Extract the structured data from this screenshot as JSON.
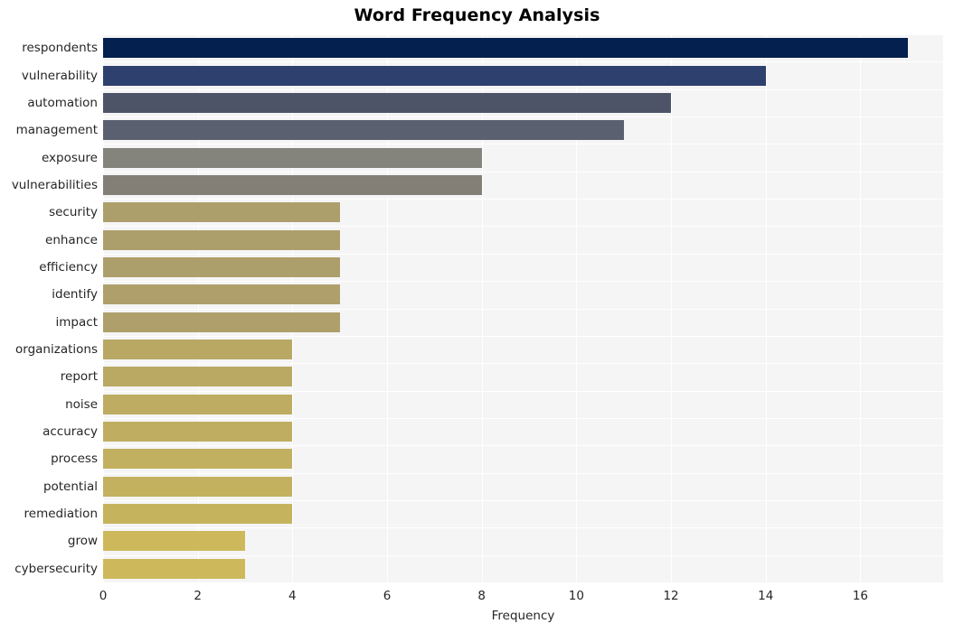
{
  "chart_data": {
    "type": "bar",
    "orientation": "horizontal",
    "title": "Word Frequency Analysis",
    "xlabel": "Frequency",
    "ylabel": "",
    "xlim": [
      0,
      17.75
    ],
    "xticks": [
      0,
      2,
      4,
      6,
      8,
      10,
      12,
      14,
      16
    ],
    "grid": true,
    "legend": null,
    "background": "#f5f5f6",
    "gridline_color": "#ffffff",
    "categories": [
      "respondents",
      "vulnerability",
      "automation",
      "management",
      "exposure",
      "vulnerabilities",
      "security",
      "enhance",
      "efficiency",
      "identify",
      "impact",
      "organizations",
      "report",
      "noise",
      "accuracy",
      "process",
      "potential",
      "remediation",
      "grow",
      "cybersecurity"
    ],
    "values": [
      17,
      14,
      12,
      11,
      8,
      8,
      5,
      5,
      5,
      5,
      5,
      4,
      4,
      4,
      4,
      4,
      4,
      4,
      3,
      3
    ],
    "colors": [
      "#04204e",
      "#2e406e",
      "#4d5468",
      "#5b6070",
      "#84837c",
      "#837f77",
      "#ad9f6c",
      "#ad9f6c",
      "#ad9f6c",
      "#ae9f6b",
      "#ae9f6b",
      "#b8a864",
      "#b9a963",
      "#bdac62",
      "#bfae61",
      "#c1b060",
      "#c3b15f",
      "#c5b35e",
      "#cdb95b",
      "#cdb95b"
    ]
  },
  "axis": {
    "xtick_labels": [
      "0",
      "2",
      "4",
      "6",
      "8",
      "10",
      "12",
      "14",
      "16"
    ],
    "xlabel_text": "Frequency"
  }
}
